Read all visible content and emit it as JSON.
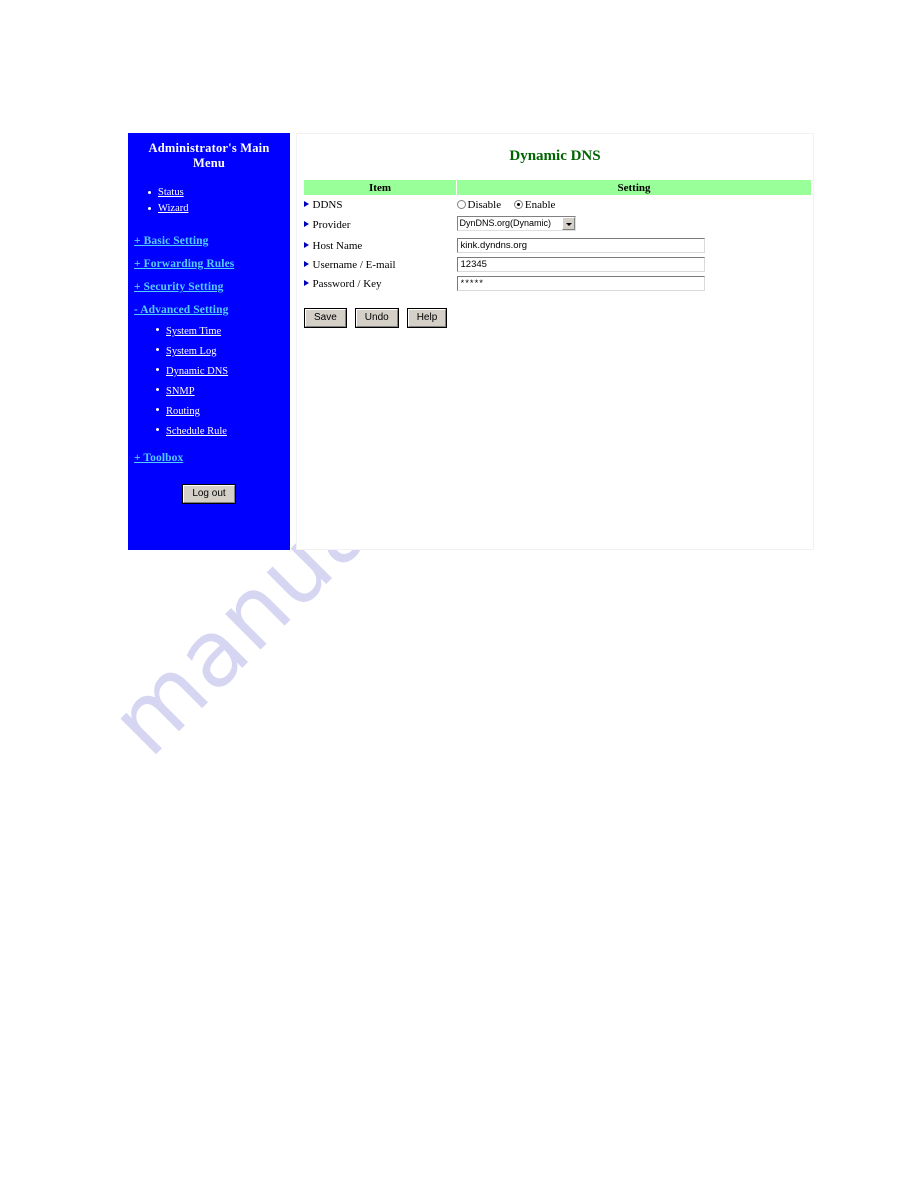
{
  "sidebar": {
    "title": "Administrator's Main Menu",
    "top_links": [
      {
        "label": "Status"
      },
      {
        "label": "Wizard"
      }
    ],
    "groups": [
      {
        "label": "+ Basic Setting",
        "expanded": false
      },
      {
        "label": "+ Forwarding Rules",
        "expanded": false
      },
      {
        "label": "+ Security Setting",
        "expanded": false
      },
      {
        "label": "- Advanced Setting",
        "expanded": true
      }
    ],
    "advanced_items": [
      {
        "label": "System Time"
      },
      {
        "label": "System Log"
      },
      {
        "label": "Dynamic DNS"
      },
      {
        "label": "SNMP"
      },
      {
        "label": "Routing"
      },
      {
        "label": "Schedule Rule"
      }
    ],
    "toolbox_label": "+ Toolbox",
    "logout_label": "Log out",
    "background_color": "#0000ff",
    "link_color": "#ffffff",
    "group_link_color": "#55ccff"
  },
  "main": {
    "title": "Dynamic DNS",
    "title_color": "#006400",
    "table": {
      "header_bg": "#99ff99",
      "columns": [
        "Item",
        "Setting"
      ],
      "rows": [
        {
          "item": "DDNS",
          "type": "radio",
          "options": [
            "Disable",
            "Enable"
          ],
          "selected": "Enable"
        },
        {
          "item": "Provider",
          "type": "select",
          "value": "DynDNS.org(Dynamic)"
        },
        {
          "item": "Host Name",
          "type": "text",
          "value": "kink.dyndns.org"
        },
        {
          "item": "Username / E-mail",
          "type": "text",
          "value": "12345"
        },
        {
          "item": "Password / Key",
          "type": "password",
          "value": "*****"
        }
      ]
    },
    "buttons": [
      {
        "label": "Save"
      },
      {
        "label": "Undo"
      },
      {
        "label": "Help"
      }
    ]
  },
  "watermark": {
    "text": "manualshive.com",
    "color": "#c9c9f0"
  }
}
